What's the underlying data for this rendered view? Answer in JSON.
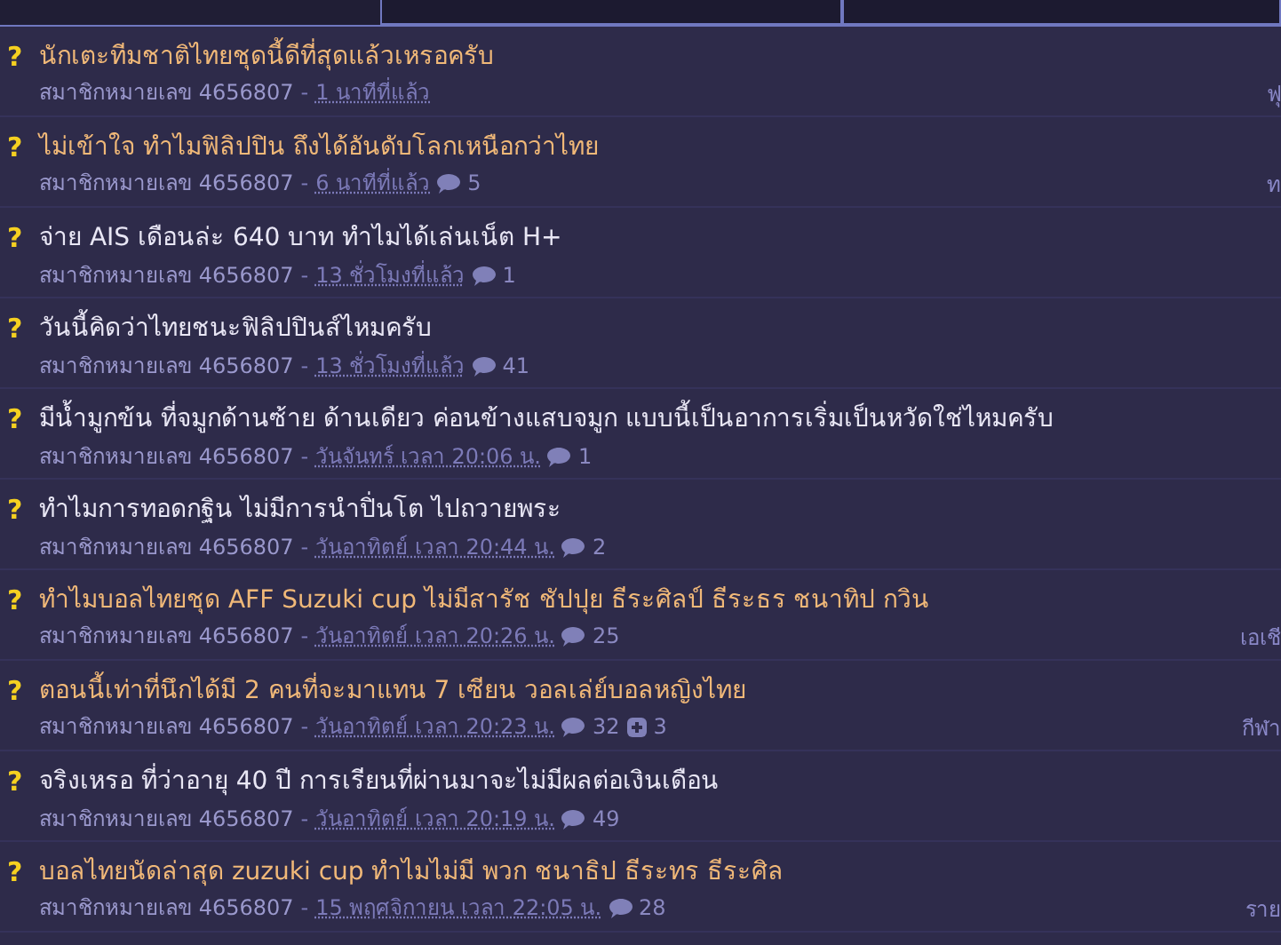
{
  "topics": [
    {
      "marker": "?",
      "title": "นักเตะทีมชาติไทยชุดนี้ดีที่สุดแล้วเหรอครับ",
      "color": "#f0b878",
      "author": "สมาชิกหมายเลข 4656807",
      "separator": "-",
      "time": "1 นาทีที่แล้ว",
      "tag": "ฟุ"
    },
    {
      "marker": "?",
      "title": "ไม่เข้าใจ ทำไมฟิลิปปิน ถึงได้อันดับโลกเหนือกว่าไทย",
      "color": "#f0b878",
      "author": "สมาชิกหมายเลข 4656807",
      "separator": "-",
      "time": "6 นาทีที่แล้ว",
      "comments": "5",
      "tag": "ท"
    },
    {
      "marker": "?",
      "title": "จ่าย AIS เดือนล่ะ 640 บาท ทำไมได้เล่นเน็ต H+",
      "color": "#e8e6f4",
      "author": "สมาชิกหมายเลข 4656807",
      "separator": "-",
      "time": "13 ชั่วโมงที่แล้ว",
      "comments": "1"
    },
    {
      "marker": "?",
      "title": "วันนี้คิดว่าไทยชนะฟิลิปปินส์ไหมครับ",
      "color": "#e8e6f4",
      "author": "สมาชิกหมายเลข 4656807",
      "separator": "-",
      "time": "13 ชั่วโมงที่แล้ว",
      "comments": "41"
    },
    {
      "marker": "?",
      "title": "มีน้ำมูกข้น ที่จมูกด้านซ้าย ด้านเดียว ค่อนข้างแสบจมูก แบบนี้เป็นอาการเริ่มเป็นหวัดใช่ไหมครับ",
      "color": "#e8e6f4",
      "author": "สมาชิกหมายเลข 4656807",
      "separator": "-",
      "time": "วันจันทร์ เวลา 20:06 น.",
      "comments": "1"
    },
    {
      "marker": "?",
      "title": "ทำไมการทอดกฐิน ไม่มีการนำปิ่นโต ไปถวายพระ",
      "color": "#e8e6f4",
      "author": "สมาชิกหมายเลข 4656807",
      "separator": "-",
      "time": "วันอาทิตย์ เวลา 20:44 น.",
      "comments": "2"
    },
    {
      "marker": "?",
      "title": "ทำไมบอลไทยชุด AFF Suzuki cup ไม่มีสารัช ชัปปุย ธีระศิลป์ ธีระธร ชนาทิป กวิน",
      "color": "#f0b878",
      "author": "สมาชิกหมายเลข 4656807",
      "separator": "-",
      "time": "วันอาทิตย์ เวลา 20:26 น.",
      "comments": "25",
      "tag": "เอเชี"
    },
    {
      "marker": "?",
      "title": "ตอนนี้เท่าที่นึกได้มี 2 คนที่จะมาแทน 7 เซียน วอลเล่ย์บอลหญิงไทย",
      "color": "#f0b878",
      "author": "สมาชิกหมายเลข 4656807",
      "separator": "-",
      "time": "วันอาทิตย์ เวลา 20:23 น.",
      "comments": "32",
      "votes": "3",
      "tag": "กีฬา"
    },
    {
      "marker": "?",
      "title": "จริงเหรอ ที่ว่าอายุ 40 ปี การเรียนที่ผ่านมาจะไม่มีผลต่อเงินเดือน",
      "color": "#e8e6f4",
      "author": "สมาชิกหมายเลข 4656807",
      "separator": "-",
      "time": "วันอาทิตย์ เวลา 20:19 น.",
      "comments": "49"
    },
    {
      "marker": "?",
      "title": "บอลไทยนัดล่าสุด zuzuki cup ทำไมไม่มี พวก ชนาธิป ธีระทร ธีระศิล",
      "color": "#f0b878",
      "author": "สมาชิกหมายเลข 4656807",
      "separator": "-",
      "time": "15 พฤศจิกายน เวลา 22:05 น.",
      "comments": "28",
      "tag": "ราย"
    }
  ]
}
